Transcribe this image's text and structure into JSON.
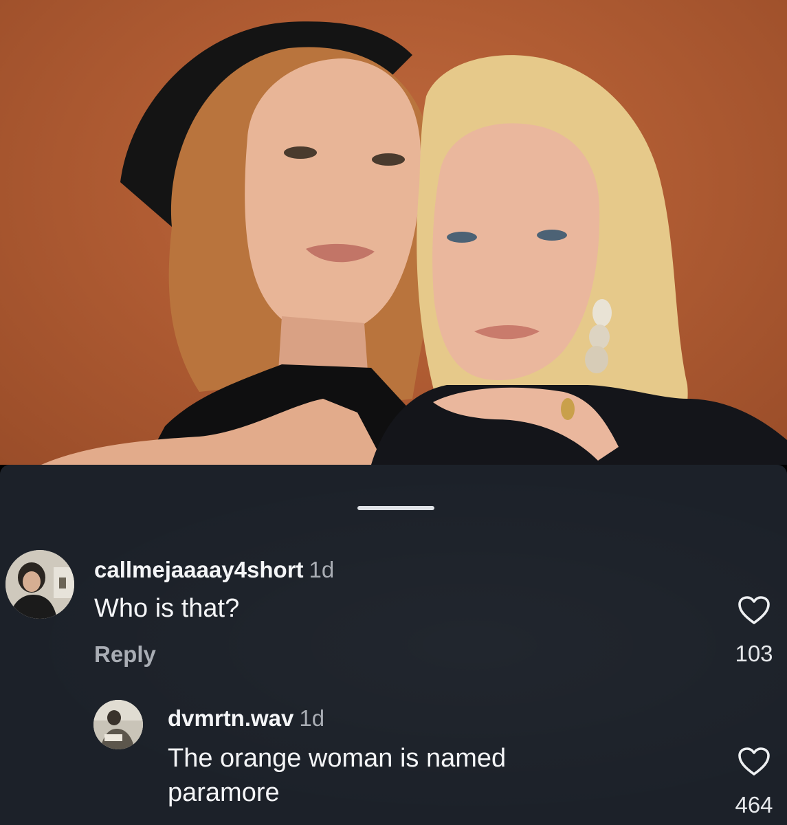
{
  "photo": {
    "background_color": "#b05c33"
  },
  "comments": [
    {
      "username": "callmejaaaay4short",
      "time": "1d",
      "text": "Who is that?",
      "reply_label": "Reply",
      "likes": "103",
      "like_icon": "heart-outline-icon"
    },
    {
      "username": "dvmrtn.wav",
      "time": "1d",
      "text": "The orange woman is named paramore",
      "likes": "464",
      "like_icon": "heart-outline-icon"
    }
  ],
  "colors": {
    "sheet_background": "#1c2129",
    "text_primary": "#f4f5f7",
    "text_secondary": "#a9adb4"
  }
}
